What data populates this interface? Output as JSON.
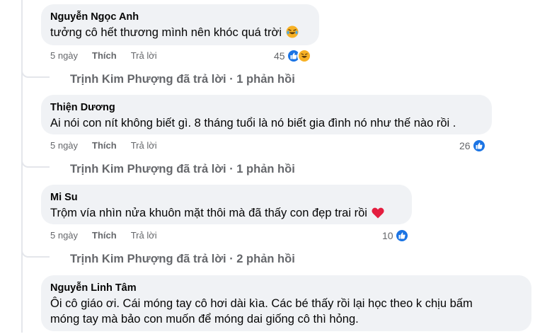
{
  "comments": [
    {
      "author": "Nguyễn Ngọc Anh",
      "text": "tưởng cô hết thương mình nên khóc quá trời",
      "text_emoji": "laughing-tears",
      "time": "5 ngày",
      "like_label": "Thích",
      "reply_label": "Trả lời",
      "reaction_count": "45",
      "reaction_icons": [
        "like",
        "haha"
      ],
      "replies": {
        "replier": "Trịnh Kim Phượng",
        "action": "đã trả lời",
        "separator": "·",
        "count": "1 phản hồi"
      }
    },
    {
      "author": "Thiện Dương",
      "text": "Ai nói con nít không biết gì. 8 tháng tuổi là nó biết gia đình nó như thế nào rồi .",
      "time": "5 ngày",
      "like_label": "Thích",
      "reply_label": "Trả lời",
      "reaction_count": "26",
      "reaction_icons": [
        "like"
      ],
      "replies": {
        "replier": "Trịnh Kim Phượng",
        "action": "đã trả lời",
        "separator": "·",
        "count": "1 phản hồi"
      }
    },
    {
      "author": "Mi Su",
      "text": "Trộm vía nhìn nửa khuôn mặt thôi mà đã thấy con đẹp trai rồi",
      "text_emoji": "red-heart",
      "time": "5 ngày",
      "like_label": "Thích",
      "reply_label": "Trả lời",
      "reaction_count": "10",
      "reaction_icons": [
        "like"
      ],
      "replies": {
        "replier": "Trịnh Kim Phượng",
        "action": "đã trả lời",
        "separator": "·",
        "count": "2 phản hồi"
      }
    },
    {
      "author": "Nguyễn Linh Tâm",
      "text_line1": "Ôi cô giáo ơi. Cái móng tay cô hơi dài kìa. Các bé thấy rồi lại học theo k chịu bấm",
      "text_line2": "móng tay mà bảo con muốn để móng dai giống cô thì hỏng."
    }
  ],
  "colors": {
    "bubble": "#f0f2f5",
    "like_blue": "#1b74e4",
    "secondary_text": "#65676b",
    "haha_yellow": "#f7b125",
    "heart_red": "#e41e3f"
  }
}
